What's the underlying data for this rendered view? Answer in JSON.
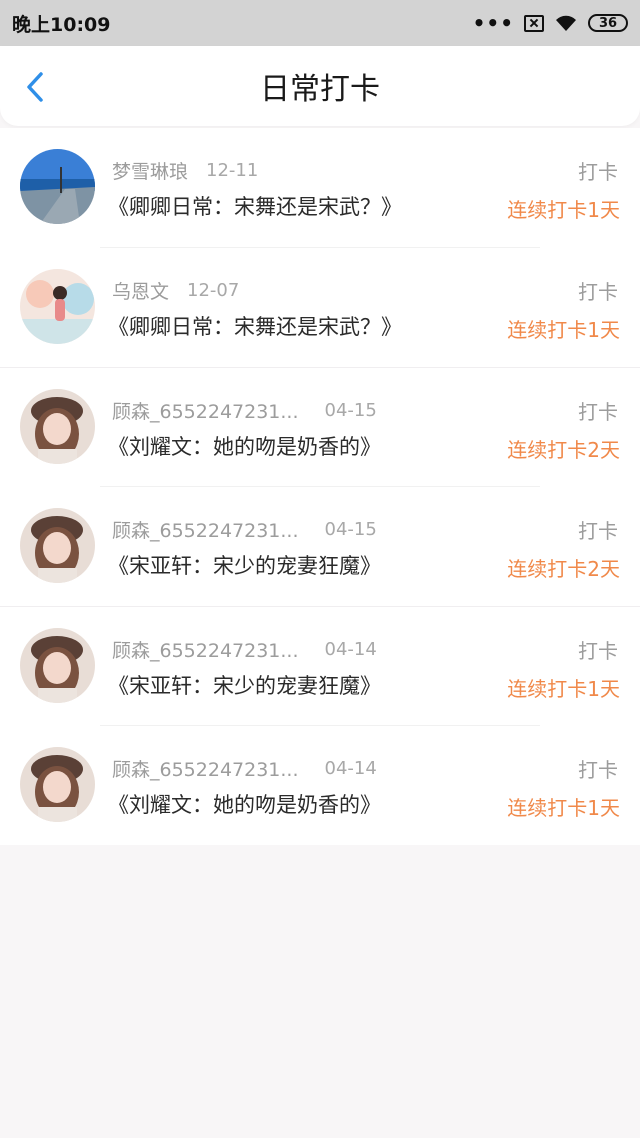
{
  "status": {
    "time": "晚上10:09",
    "battery": "36"
  },
  "header": {
    "title": "日常打卡"
  },
  "checkins": [
    {
      "user": "梦雪琳琅",
      "date": "12-11",
      "book": "《卿卿日常：宋舞还是宋武？》",
      "action": "打卡",
      "streak": "连续打卡1天"
    },
    {
      "user": "乌恩文",
      "date": "12-07",
      "book": "《卿卿日常：宋舞还是宋武？》",
      "action": "打卡",
      "streak": "连续打卡1天"
    },
    {
      "user": "顾森_6552247231...",
      "date": "04-15",
      "book": "《刘耀文：她的吻是奶香的》",
      "action": "打卡",
      "streak": "连续打卡2天"
    },
    {
      "user": "顾森_6552247231...",
      "date": "04-15",
      "book": "《宋亚轩：宋少的宠妻狂魔》",
      "action": "打卡",
      "streak": "连续打卡2天"
    },
    {
      "user": "顾森_6552247231...",
      "date": "04-14",
      "book": "《宋亚轩：宋少的宠妻狂魔》",
      "action": "打卡",
      "streak": "连续打卡1天"
    },
    {
      "user": "顾森_6552247231...",
      "date": "04-14",
      "book": "《刘耀文：她的吻是奶香的》",
      "action": "打卡",
      "streak": "连续打卡1天"
    }
  ],
  "colors": {
    "accent_blue": "#2f8fe8",
    "streak_orange": "#f0894a"
  }
}
